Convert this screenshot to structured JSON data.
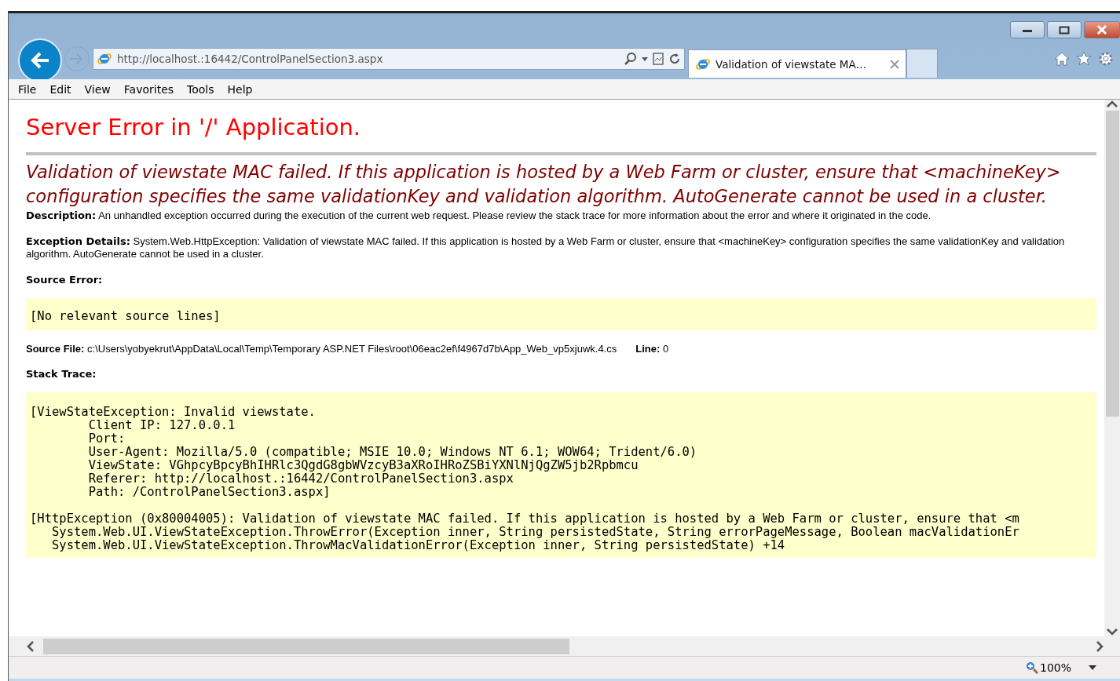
{
  "browser": {
    "address": "http://localhost.:16442/ControlPanelSection3.aspx",
    "tabs": [
      {
        "label": "Validation of viewstate MA…",
        "selected": true
      }
    ],
    "menu": [
      "File",
      "Edit",
      "View",
      "Favorites",
      "Tools",
      "Help"
    ],
    "zoom": "100%"
  },
  "page": {
    "title": "Server Error in '/' Application.",
    "message": "Validation of viewstate MAC failed. If this application is hosted by a Web Farm or cluster, ensure that <machineKey> configuration specifies the same validationKey and validation algorithm. AutoGenerate cannot be used in a cluster.",
    "description": "**Description:** An unhandled exception occurred during the execution of the current web request. Please review the stack trace for more information about the error and where it originated in the code.",
    "exception_details": "**Exception Details:** System.Web.HttpException: Validation of viewstate MAC failed. If this application is hosted by a Web Farm or cluster, ensure that <machineKey> configuration specifies the same validationKey and validation algorithm. AutoGenerate cannot be used in a cluster.",
    "source_error": {
      "heading": "Source Error:",
      "lines": [
        "[No relevant source lines]"
      ]
    },
    "source_file": {
      "path": "**Source File:** c:\\Users\\yobyekrut\\AppData\\Local\\Temp\\Temporary ASP.NET Files\\root\\06eac2ef\\f4967d7b\\App_Web_vp5xjuwk.4.cs",
      "line": "**Line:** 0"
    },
    "stack_trace": {
      "heading": "Stack Trace:",
      "blocks": [
        {
          "lines": [
            "[ViewStateException: Invalid viewstate.",
            "        Client IP: 127.0.0.1",
            "        Port: ",
            "        User-Agent: Mozilla/5.0 (compatible; MSIE 10.0; Windows NT 6.1; WOW64; Trident/6.0)",
            "        ViewState: VGhpcyBpcyBhIHRlc3QgdG8gbWVzcyB3aXRoIHRoZSBiYXNlNjQgZW5jb2Rpbmcu",
            "        Referer: http://localhost.:16442/ControlPanelSection3.aspx",
            "        Path: /ControlPanelSection3.aspx]"
          ]
        },
        {
          "lines": [
            "[HttpException (0x80004005): Validation of viewstate MAC failed. If this application is hosted by a Web Farm or cluster, ensure that <m",
            "   System.Web.UI.ViewStateException.ThrowError(Exception inner, String persistedState, String errorPageMessage, Boolean macValidationEr",
            "   System.Web.UI.ViewStateException.ThrowMacValidationError(Exception inner, String persistedState) +14"
          ]
        }
      ]
    }
  }
}
